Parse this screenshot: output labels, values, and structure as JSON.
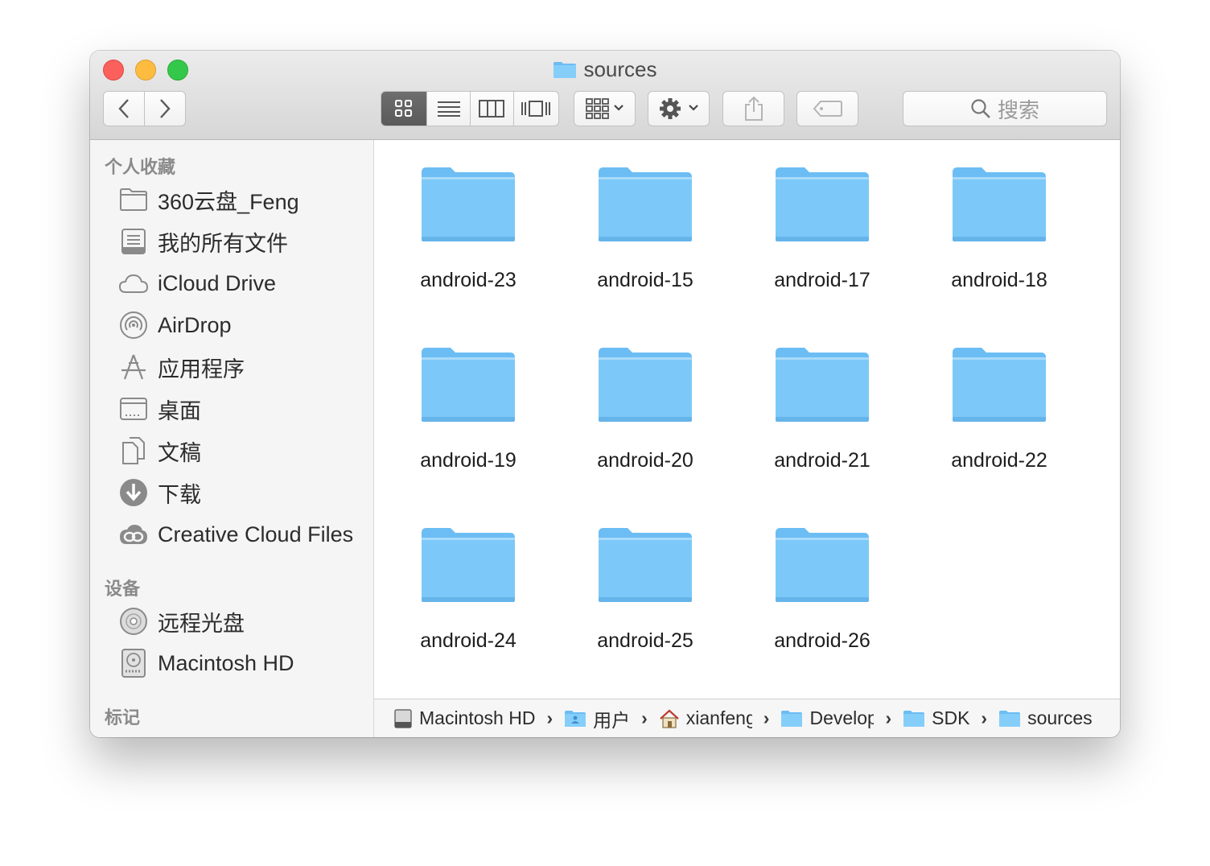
{
  "window": {
    "title": "sources"
  },
  "toolbar": {
    "back_icon": "chevron-left-icon",
    "forward_icon": "chevron-right-icon",
    "view_modes": [
      "icon-view",
      "list-view",
      "column-view",
      "cover-flow-view"
    ],
    "active_view": "icon-view",
    "group_icon": "group-grid-icon",
    "action_icon": "gear-icon",
    "share_icon": "share-icon",
    "tag_icon": "tag-icon",
    "search_placeholder": "搜索"
  },
  "sidebar": {
    "favorites_header": "个人收藏",
    "favorites": [
      {
        "label": "360云盘_Feng",
        "icon": "folder-icon"
      },
      {
        "label": "我的所有文件",
        "icon": "all-files-icon"
      },
      {
        "label": "iCloud Drive",
        "icon": "cloud-icon"
      },
      {
        "label": "AirDrop",
        "icon": "airdrop-icon"
      },
      {
        "label": "应用程序",
        "icon": "applications-icon"
      },
      {
        "label": "桌面",
        "icon": "desktop-icon"
      },
      {
        "label": "文稿",
        "icon": "documents-icon"
      },
      {
        "label": "下载",
        "icon": "download-icon"
      },
      {
        "label": "Creative Cloud Files",
        "icon": "creative-cloud-icon"
      }
    ],
    "devices_header": "设备",
    "devices": [
      {
        "label": "远程光盘",
        "icon": "disc-icon"
      },
      {
        "label": "Macintosh HD",
        "icon": "hard-drive-icon"
      }
    ],
    "tags_header": "标记"
  },
  "content": {
    "folders": [
      "android-23",
      "android-15",
      "android-17",
      "android-18",
      "android-19",
      "android-20",
      "android-21",
      "android-22",
      "android-24",
      "android-25",
      "android-26"
    ]
  },
  "pathbar": {
    "crumbs": [
      {
        "label": "Macintosh HD",
        "icon": "hard-drive-icon"
      },
      {
        "label": "用户",
        "icon": "users-folder-icon"
      },
      {
        "label": "xianfeng",
        "icon": "home-icon"
      },
      {
        "label": "Develop",
        "icon": "folder-icon"
      },
      {
        "label": "SDK",
        "icon": "folder-icon"
      },
      {
        "label": "sources",
        "icon": "folder-icon"
      }
    ],
    "separator": "›"
  },
  "colors": {
    "folder": "#7cc8f8",
    "folder_tab": "#6cbdf3",
    "close": "#fc605c",
    "minimize": "#fdbc40",
    "maximize": "#34c84a"
  }
}
